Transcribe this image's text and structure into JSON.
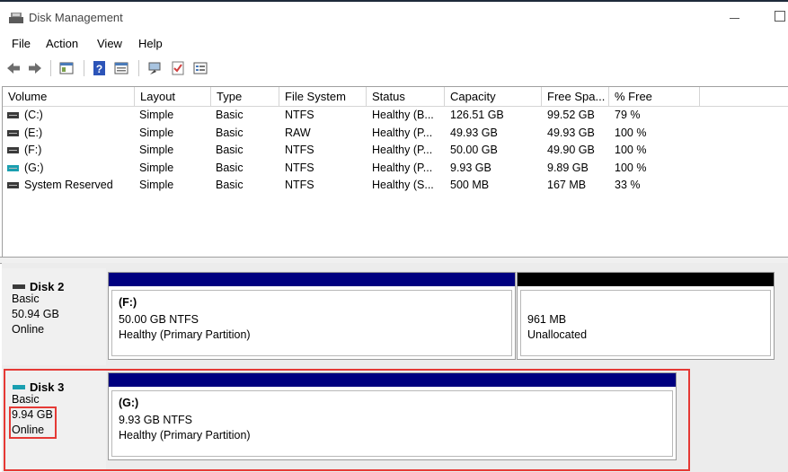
{
  "window": {
    "title": "Disk Management"
  },
  "menu": [
    "File",
    "Action",
    "View",
    "Help"
  ],
  "toolbar": {
    "icons": [
      "back-arrow-icon",
      "forward-arrow-icon",
      "show-hide-console-tree-icon",
      "help-icon",
      "properties-icon",
      "connect-icon",
      "checklist-icon",
      "list-view-icon"
    ]
  },
  "table": {
    "columns": [
      "Volume",
      "Layout",
      "Type",
      "File System",
      "Status",
      "Capacity",
      "Free Spa...",
      "% Free"
    ],
    "rows": [
      {
        "volume": "(C:)",
        "layout": "Simple",
        "type": "Basic",
        "fs": "NTFS",
        "status": "Healthy (B...",
        "capacity": "126.51 GB",
        "free": "99.52 GB",
        "pct": "79 %",
        "icon_color": "#3a3a3a"
      },
      {
        "volume": "(E:)",
        "layout": "Simple",
        "type": "Basic",
        "fs": "RAW",
        "status": "Healthy (P...",
        "capacity": "49.93 GB",
        "free": "49.93 GB",
        "pct": "100 %",
        "icon_color": "#3a3a3a"
      },
      {
        "volume": "(F:)",
        "layout": "Simple",
        "type": "Basic",
        "fs": "NTFS",
        "status": "Healthy (P...",
        "capacity": "50.00 GB",
        "free": "49.90 GB",
        "pct": "100 %",
        "icon_color": "#3a3a3a"
      },
      {
        "volume": "(G:)",
        "layout": "Simple",
        "type": "Basic",
        "fs": "NTFS",
        "status": "Healthy (P...",
        "capacity": "9.93 GB",
        "free": "9.89 GB",
        "pct": "100 %",
        "icon_color": "#1a9fb0"
      },
      {
        "volume": "System Reserved",
        "layout": "Simple",
        "type": "Basic",
        "fs": "NTFS",
        "status": "Healthy (S...",
        "capacity": "500 MB",
        "free": "167 MB",
        "pct": "33 %",
        "icon_color": "#3a3a3a"
      }
    ]
  },
  "disks": [
    {
      "name": "Disk 2",
      "type": "Basic",
      "size": "50.94 GB",
      "status": "Online",
      "partitions": [
        {
          "label": "(F:)",
          "line1": "50.00 GB NTFS",
          "line2": "Healthy (Primary Partition)",
          "bar_color": "#000080"
        },
        {
          "label": "",
          "line1": "961 MB",
          "line2": "Unallocated",
          "bar_color": "#000000"
        }
      ]
    },
    {
      "name": "Disk 3",
      "type": "Basic",
      "size": "9.94 GB",
      "status": "Online",
      "partitions": [
        {
          "label": "(G:)",
          "line1": "9.93 GB NTFS",
          "line2": "Healthy (Primary Partition)",
          "bar_color": "#000080"
        }
      ]
    }
  ],
  "colors": {
    "highlight": "#e53935",
    "primary_partition": "#000080",
    "unallocated": "#000000"
  }
}
